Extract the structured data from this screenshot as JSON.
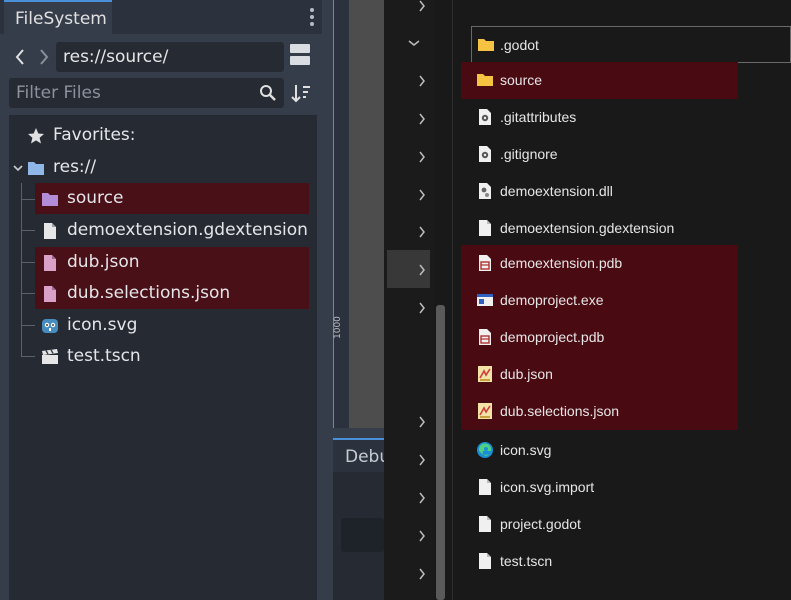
{
  "godot": {
    "tab_label": "FileSystem",
    "path": "res://source/",
    "filter_placeholder": "Filter Files",
    "favorites_label": "Favorites:",
    "root_label": "res://",
    "tree_items": [
      {
        "label": "source",
        "icon": "folder-icon",
        "selected": true
      },
      {
        "label": "demoextension.gdextension",
        "icon": "file-icon",
        "selected": false
      },
      {
        "label": "dub.json",
        "icon": "file-icon",
        "selected": true
      },
      {
        "label": "dub.selections.json",
        "icon": "file-icon",
        "selected": true
      },
      {
        "label": "icon.svg",
        "icon": "godot-icon",
        "selected": false
      },
      {
        "label": "test.tscn",
        "icon": "scene-icon",
        "selected": false
      }
    ]
  },
  "middle": {
    "ruler_label": "1000",
    "debug_tab_label": "Debu"
  },
  "explorer": {
    "items": [
      {
        "label": ".godot",
        "icon": "folder-icon",
        "state": "focus"
      },
      {
        "label": "source",
        "icon": "folder-icon",
        "state": "selected"
      },
      {
        "label": ".gitattributes",
        "icon": "config-file-icon",
        "state": "normal"
      },
      {
        "label": ".gitignore",
        "icon": "config-file-icon",
        "state": "normal"
      },
      {
        "label": "demoextension.dll",
        "icon": "dll-file-icon",
        "state": "normal"
      },
      {
        "label": "demoextension.gdextension",
        "icon": "file-icon",
        "state": "normal"
      },
      {
        "label": "demoextension.pdb",
        "icon": "pdb-file-icon",
        "state": "selected"
      },
      {
        "label": "demoproject.exe",
        "icon": "exe-file-icon",
        "state": "selected"
      },
      {
        "label": "demoproject.pdb",
        "icon": "pdb-file-icon",
        "state": "selected"
      },
      {
        "label": "dub.json",
        "icon": "json-file-icon",
        "state": "selected"
      },
      {
        "label": "dub.selections.json",
        "icon": "json-file-icon",
        "state": "selected"
      },
      {
        "label": "icon.svg",
        "icon": "edge-icon",
        "state": "normal"
      },
      {
        "label": "icon.svg.import",
        "icon": "file-icon",
        "state": "normal"
      },
      {
        "label": "project.godot",
        "icon": "file-icon",
        "state": "normal"
      },
      {
        "label": "test.tscn",
        "icon": "file-icon",
        "state": "normal"
      }
    ]
  },
  "colors": {
    "selection_godot": "#4a1018",
    "selection_explorer": "#4a0a12",
    "accent": "#4a90d9",
    "folder_godot": "#b38cd8",
    "folder_explorer": "#f5c242"
  }
}
